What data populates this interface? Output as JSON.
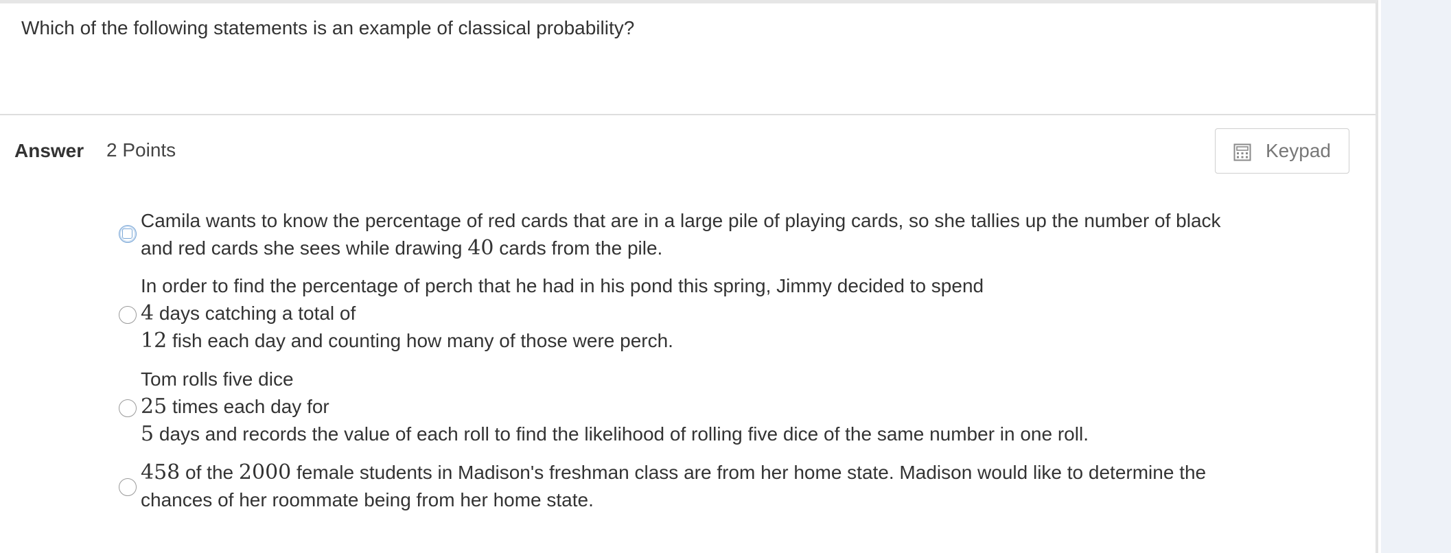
{
  "question": {
    "text": "Which of the following statements is an example of classical probability?"
  },
  "answer_header": {
    "answer_label": "Answer",
    "points_label": "2 Points",
    "keypad_label": "Keypad"
  },
  "icons": {
    "keypad": "calculator-icon"
  },
  "colors": {
    "focus_ring": "#7aa7d6",
    "right_rail": "#eef2f8",
    "text": "#333333"
  },
  "options": [
    {
      "line1": "Camila wants to know the percentage of red cards that are in a large pile of playing cards, so she tallies up the number of black",
      "line2_pre": "and red cards she sees while drawing ",
      "line2_num": "40",
      "line2_post": " cards from the pile."
    },
    {
      "line1": "In order to find the percentage of perch that he had in his pond this spring, Jimmy decided to spend",
      "line2_num": "4",
      "line2_post": " days catching a total of",
      "line3_num": "12",
      "line3_post": " fish each day and counting how many of those were perch."
    },
    {
      "line1": "Tom rolls five dice",
      "line2_num": "25",
      "line2_post": " times each day for",
      "line3_num": "5",
      "line3_post": " days and records the value of each roll to find the likelihood of rolling five dice of the same number in one roll."
    },
    {
      "line1_num1": "458",
      "line1_mid": " of the ",
      "line1_num2": "2000",
      "line1_post": " female students in Madison's freshman class are from her home state. Madison would like to determine the",
      "line2": "chances of her roommate being from her home state."
    }
  ]
}
